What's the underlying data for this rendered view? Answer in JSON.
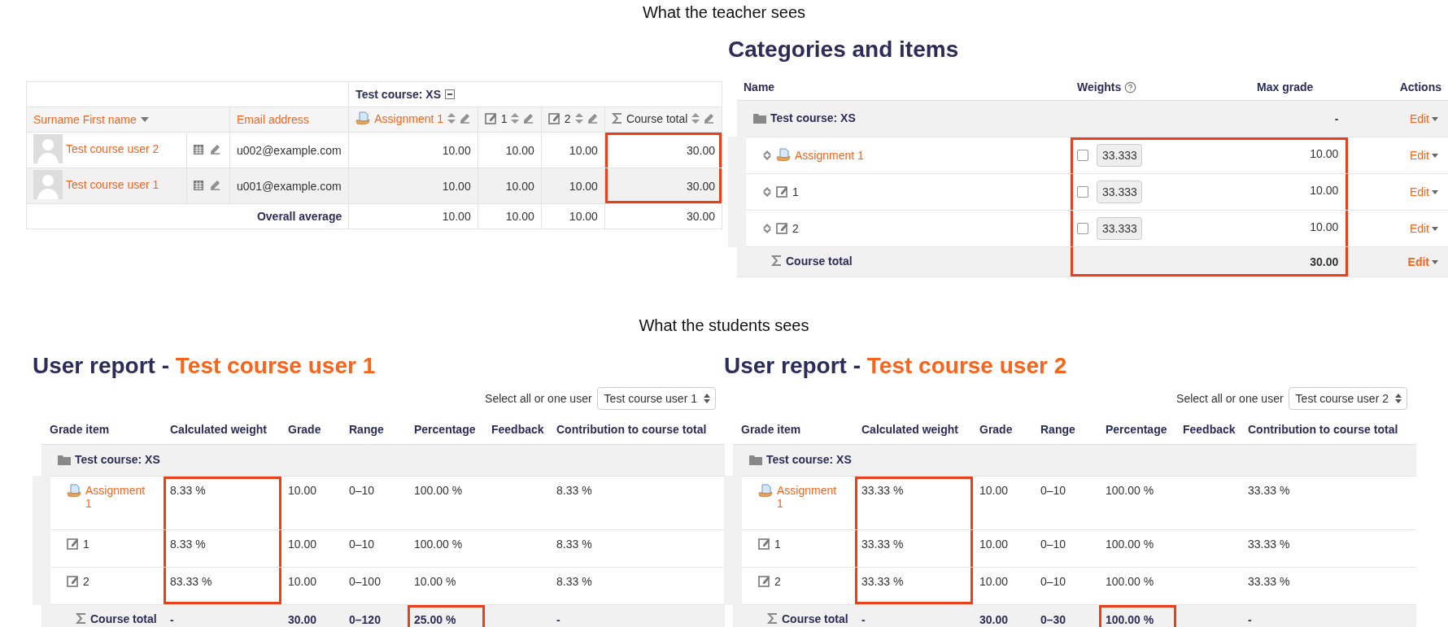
{
  "teacher_caption": "What the teacher sees",
  "grader": {
    "category": "Test course: XS",
    "columns": [
      {
        "kind": "name",
        "label": "Surname First name"
      },
      {
        "kind": "email",
        "label": "Email address"
      },
      {
        "kind": "assignment",
        "label": "Assignment 1"
      },
      {
        "kind": "manual",
        "label": "1"
      },
      {
        "kind": "manual",
        "label": "2"
      },
      {
        "kind": "total",
        "label": "Course total"
      }
    ],
    "rows": [
      {
        "name": "Test course user 2",
        "email": "u002@example.com",
        "grades": [
          "10.00",
          "10.00",
          "10.00",
          {
            "text": "30.00",
            "marked": true
          }
        ]
      },
      {
        "name": "Test course user 1",
        "email": "u001@example.com",
        "grades": [
          "10.00",
          "10.00",
          "10.00",
          {
            "text": "30.00",
            "marked": true
          }
        ]
      }
    ],
    "average": {
      "label": "Overall average",
      "grades": [
        "10.00",
        "10.00",
        "10.00",
        "30.00"
      ]
    }
  },
  "categories": {
    "title": "Categories and items",
    "columns": [
      "Name",
      "Weights",
      "Max grade",
      "Actions"
    ],
    "rows": [
      {
        "kind": "category",
        "name": "Test course: XS",
        "max": "-",
        "action": "Edit",
        "marked": false
      },
      {
        "kind": "assignment",
        "name": "Assignment 1",
        "weight": "33.333",
        "checked": false,
        "max": "10.00",
        "action": "Edit",
        "marked": true
      },
      {
        "kind": "manual",
        "name": "1",
        "weight": "33.333",
        "checked": false,
        "max": "10.00",
        "action": "Edit",
        "marked": true
      },
      {
        "kind": "manual",
        "name": "2",
        "weight": "33.333",
        "checked": false,
        "max": "10.00",
        "action": "Edit",
        "marked": true
      },
      {
        "kind": "total",
        "name": "Course total",
        "max": "30.00",
        "action": "Edit",
        "marked": true
      }
    ]
  },
  "student_caption": "What the students sees",
  "user_reports": [
    {
      "title": "User report -",
      "user": "Test course user 1",
      "select_label": "Select all or one user",
      "select_value": "Test course user 1",
      "columns": [
        "Grade item",
        "Calculated weight",
        "Grade",
        "Range",
        "Percentage",
        "Feedback",
        "Contribution to course total"
      ],
      "rows": [
        {
          "kind": "category",
          "name": "Test course: XS"
        },
        {
          "kind": "assignment",
          "name": "Assignment 1",
          "weight": {
            "text": "8.33 %",
            "marked": true
          },
          "grade": "10.00",
          "range": "0–10",
          "percentage": "100.00 %",
          "contribution": "8.33 %"
        },
        {
          "kind": "manual",
          "name": "1",
          "weight": {
            "text": "8.33 %",
            "marked": true
          },
          "grade": "10.00",
          "range": "0–10",
          "percentage": "100.00 %",
          "contribution": "8.33 %"
        },
        {
          "kind": "manual",
          "name": "2",
          "weight": {
            "text": "83.33 %",
            "marked": true
          },
          "grade": "10.00",
          "range": "0–100",
          "percentage": "10.00 %",
          "contribution": "8.33 %"
        },
        {
          "kind": "total",
          "name": "Course total",
          "weight": "-",
          "grade": "30.00",
          "range": "0–120",
          "percentage": {
            "text": "25.00 %",
            "marked": true
          },
          "contribution": "-"
        }
      ]
    },
    {
      "title": "User report -",
      "user": "Test course user 2",
      "select_label": "Select all or one user",
      "select_value": "Test course user 2",
      "columns": [
        "Grade item",
        "Calculated weight",
        "Grade",
        "Range",
        "Percentage",
        "Feedback",
        "Contribution to course total"
      ],
      "rows": [
        {
          "kind": "category",
          "name": "Test course: XS"
        },
        {
          "kind": "assignment",
          "name": "Assignment 1",
          "weight": {
            "text": "33.33 %",
            "marked": true
          },
          "grade": "10.00",
          "range": "0–10",
          "percentage": "100.00 %",
          "contribution": "33.33 %"
        },
        {
          "kind": "manual",
          "name": "1",
          "weight": {
            "text": "33.33 %",
            "marked": true
          },
          "grade": "10.00",
          "range": "0–10",
          "percentage": "100.00 %",
          "contribution": "33.33 %"
        },
        {
          "kind": "manual",
          "name": "2",
          "weight": {
            "text": "33.33 %",
            "marked": true
          },
          "grade": "10.00",
          "range": "0–10",
          "percentage": "100.00 %",
          "contribution": "33.33 %"
        },
        {
          "kind": "total",
          "name": "Course total",
          "weight": "-",
          "grade": "30.00",
          "range": "0–30",
          "percentage": {
            "text": "100.00 %",
            "marked": true
          },
          "contribution": "-"
        }
      ]
    }
  ]
}
